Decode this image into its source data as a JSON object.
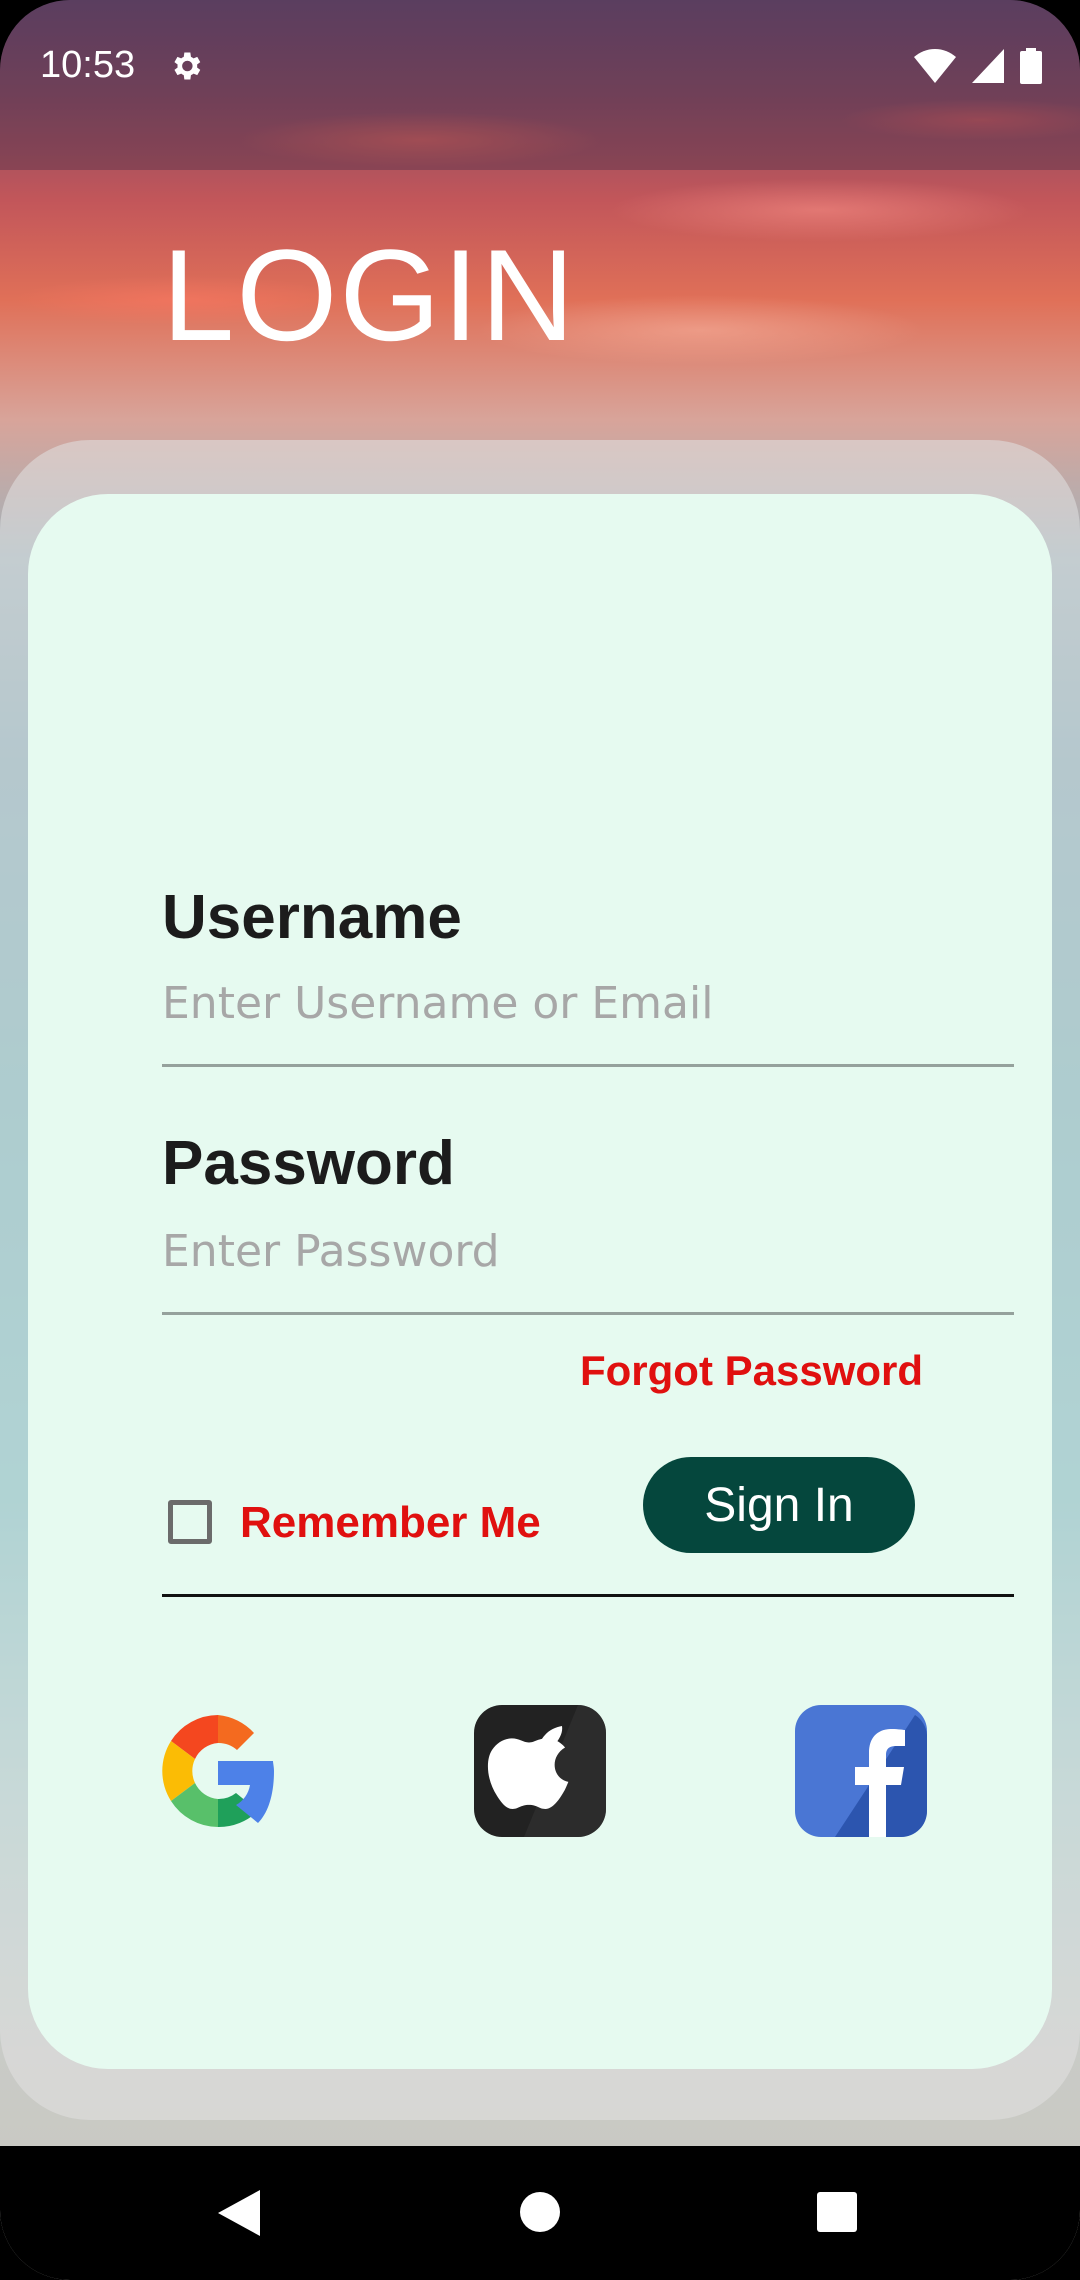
{
  "status_bar": {
    "time": "10:53",
    "icons": [
      "gear-icon",
      "wifi-icon",
      "signal-icon",
      "battery-icon"
    ]
  },
  "page": {
    "title": "LOGIN"
  },
  "form": {
    "username": {
      "label": "Username",
      "placeholder": "Enter Username or Email",
      "value": ""
    },
    "password": {
      "label": "Password",
      "placeholder": "Enter Password",
      "value": ""
    },
    "forgot_password": "Forgot Password",
    "remember_me": "Remember Me",
    "remember_checked": false,
    "sign_in": "Sign In"
  },
  "social": [
    "google-icon",
    "apple-icon",
    "facebook-icon"
  ],
  "colors": {
    "accent_red": "#e0100f",
    "button_green": "#05473d",
    "card_background": "#e6faf0"
  },
  "nav_bar": [
    "back-icon",
    "home-icon",
    "recents-icon"
  ]
}
